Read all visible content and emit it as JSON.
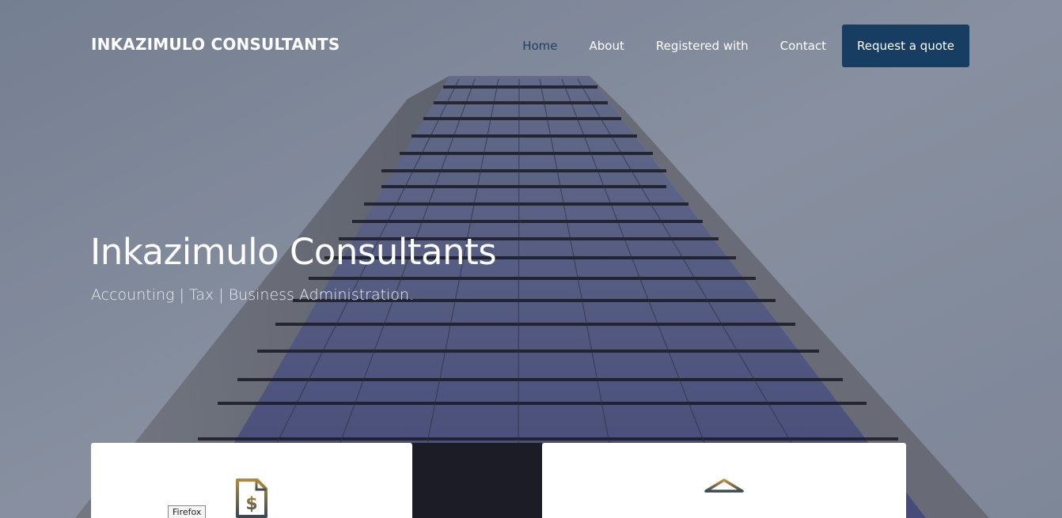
{
  "brand": "INKAZIMULO CONSULTANTS",
  "nav": {
    "items": [
      "Home",
      "About",
      "Registered with",
      "Contact"
    ],
    "active": "Home",
    "quote_button": "Request a quote"
  },
  "hero": {
    "title": "Inkazimulo Consultants",
    "subtitle": "Accounting | Tax | Business Administration."
  },
  "cards": {
    "left_icon": "document-dollar-icon",
    "right_icon": "bank-building-icon"
  },
  "tooltip": "Firefox",
  "colors": {
    "accent": "#173d62",
    "active_nav": "#1f3f66",
    "icon_gold": "#b08a3a",
    "icon_dark": "#3a4a52"
  }
}
